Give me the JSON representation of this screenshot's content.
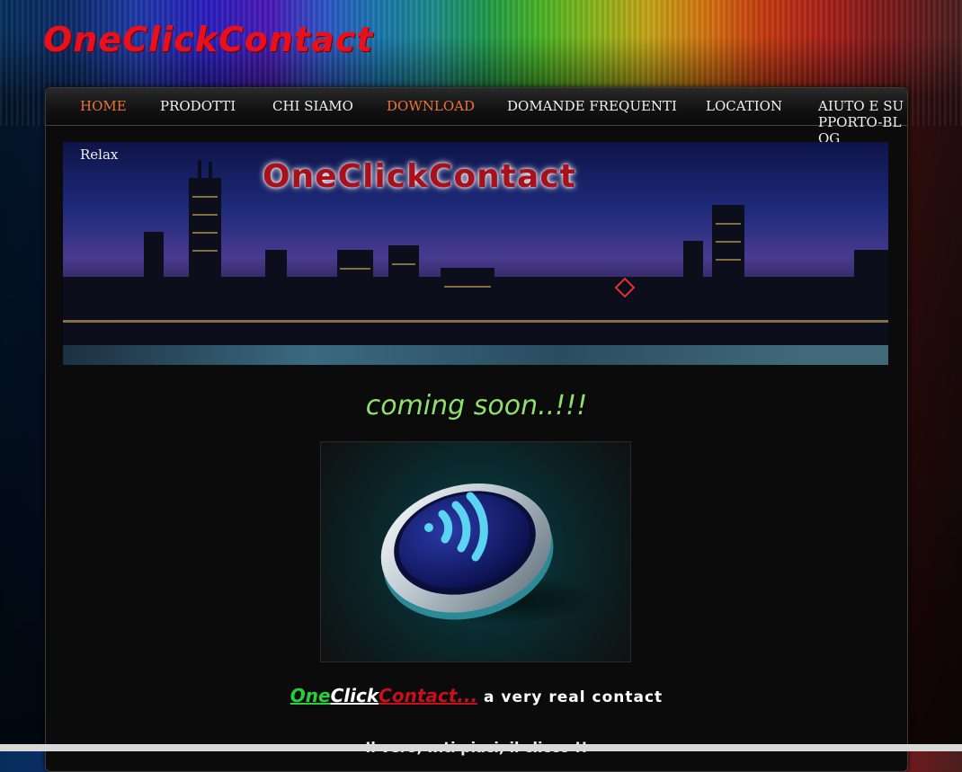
{
  "site": {
    "title": "OneClickContact"
  },
  "nav": {
    "items": [
      {
        "label": "Home",
        "active": true
      },
      {
        "label": "Prodotti",
        "active": false
      },
      {
        "label": "Chi Siamo",
        "active": false
      },
      {
        "label": "Download",
        "active": true
      },
      {
        "label": "Domande frequenti",
        "active": false
      },
      {
        "label": "Location",
        "active": false
      },
      {
        "label": "Aiuto e Supporto-Blog",
        "active": false
      },
      {
        "label": "Relax",
        "active": false
      }
    ]
  },
  "banner": {
    "title": "OneClickContact"
  },
  "main": {
    "coming_soon": "coming soon..!!!",
    "tagline": {
      "one": "One",
      "click": "Click",
      "contact": "Contact...",
      "rest": " a very real contact"
    },
    "subline": "Il vero, ...ti piaci, il clicco !!"
  },
  "colors": {
    "accent": "#e8743a",
    "brand_red": "#e8101c",
    "green": "#8ee06a"
  }
}
